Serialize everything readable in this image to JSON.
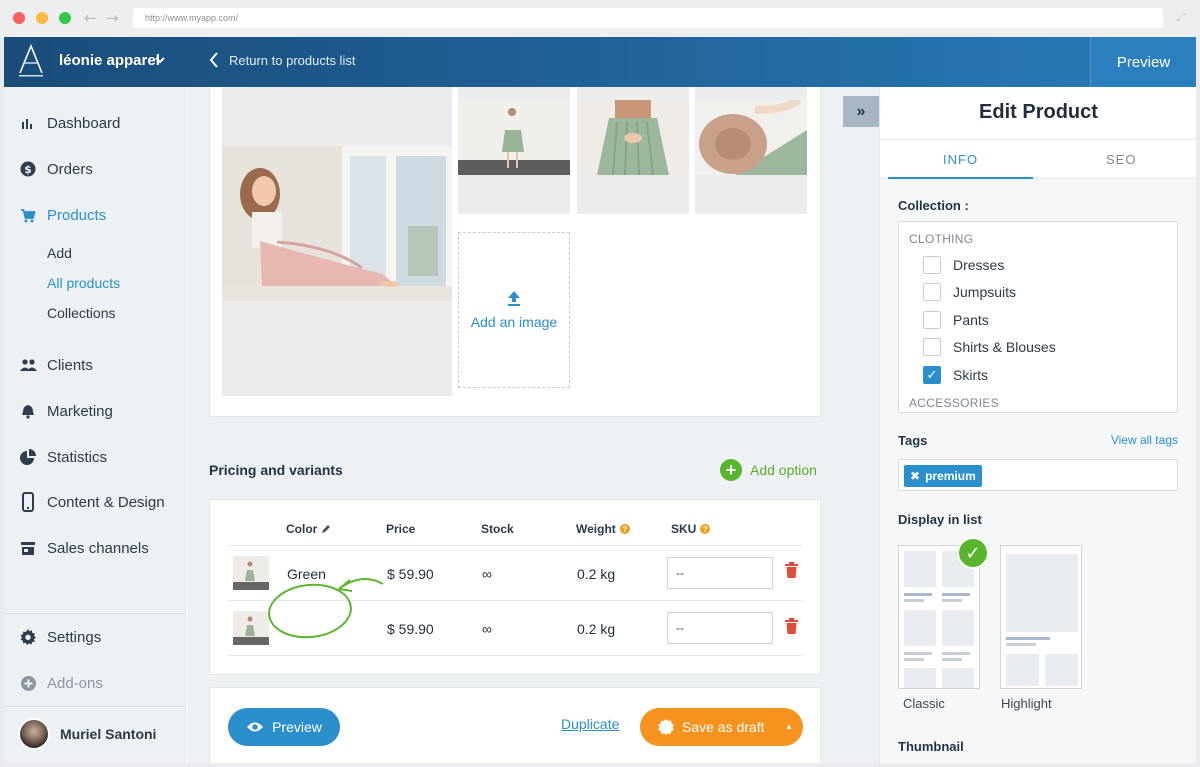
{
  "browser": {
    "url": "http://www.myapp.com/"
  },
  "header": {
    "brand": "léonie apparel",
    "back_label": "Return to products list",
    "preview_label": "Preview"
  },
  "sidebar": {
    "items": [
      {
        "label": "Dashboard",
        "icon": "bar-chart-icon"
      },
      {
        "label": "Orders",
        "icon": "dollar-icon"
      },
      {
        "label": "Products",
        "icon": "cart-icon"
      },
      {
        "label": "Clients",
        "icon": "people-icon"
      },
      {
        "label": "Marketing",
        "icon": "bell-icon"
      },
      {
        "label": "Statistics",
        "icon": "pie-icon"
      },
      {
        "label": "Content & Design",
        "icon": "phone-icon"
      },
      {
        "label": "Sales channels",
        "icon": "store-icon"
      }
    ],
    "sub_items": [
      "Add",
      "All products",
      "Collections"
    ],
    "settings": "Settings",
    "addons": "Add-ons",
    "user_name": "Muriel Santoni"
  },
  "gallery": {
    "add_image_label": "Add an image"
  },
  "pricing": {
    "title": "Pricing and variants",
    "add_option": "Add option",
    "columns": {
      "color": "Color",
      "price": "Price",
      "stock": "Stock",
      "weight": "Weight",
      "sku": "SKU"
    },
    "rows": [
      {
        "color": "Green",
        "price": "$ 59.90",
        "stock": "∞",
        "weight": "0.2 kg",
        "sku": "--"
      },
      {
        "color": "",
        "price": "$ 59.90",
        "stock": "∞",
        "weight": "0.2 kg",
        "sku": "--"
      }
    ]
  },
  "actions": {
    "preview": "Preview",
    "duplicate": "Duplicate",
    "save_draft": "Save as draft"
  },
  "panel": {
    "title": "Edit Product",
    "tabs": [
      "INFO",
      "SEO"
    ],
    "collection_label": "Collection :",
    "groups": {
      "clothing": "CLOTHING",
      "accessories": "ACCESSORIES"
    },
    "collections": [
      {
        "label": "Dresses",
        "checked": false
      },
      {
        "label": "Jumpsuits",
        "checked": false
      },
      {
        "label": "Pants",
        "checked": false
      },
      {
        "label": "Shirts & Blouses",
        "checked": false
      },
      {
        "label": "Skirts",
        "checked": true
      }
    ],
    "tags_label": "Tags",
    "view_all_tags": "View all tags",
    "tags": [
      "premium"
    ],
    "display_label": "Display in list",
    "layouts": [
      {
        "label": "Classic",
        "selected": true
      },
      {
        "label": "Highlight",
        "selected": false
      }
    ],
    "thumbnail_label": "Thumbnail"
  },
  "colors": {
    "accent": "#2b8fcc",
    "success": "#5ab52e",
    "warning": "#f6921e",
    "danger": "#e14b3b"
  }
}
